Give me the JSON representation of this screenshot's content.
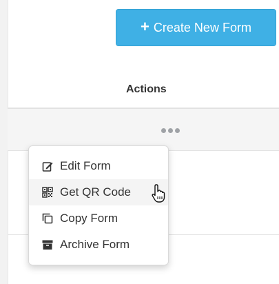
{
  "toolbar": {
    "create_button": {
      "icon": "plus-icon",
      "label": "Create New Form",
      "color": "#3fb0e5"
    }
  },
  "table": {
    "header": {
      "actions_label": "Actions"
    },
    "row": {
      "more_icon": "ellipsis-icon"
    }
  },
  "menu": {
    "items": [
      {
        "label": "Edit Form",
        "icon": "edit-icon"
      },
      {
        "label": "Get QR Code",
        "icon": "qr-code-icon",
        "hovered": true
      },
      {
        "label": "Copy Form",
        "icon": "copy-icon"
      },
      {
        "label": "Archive Form",
        "icon": "archive-icon"
      }
    ]
  },
  "cursor": {
    "icon": "hand-pointer-icon"
  }
}
